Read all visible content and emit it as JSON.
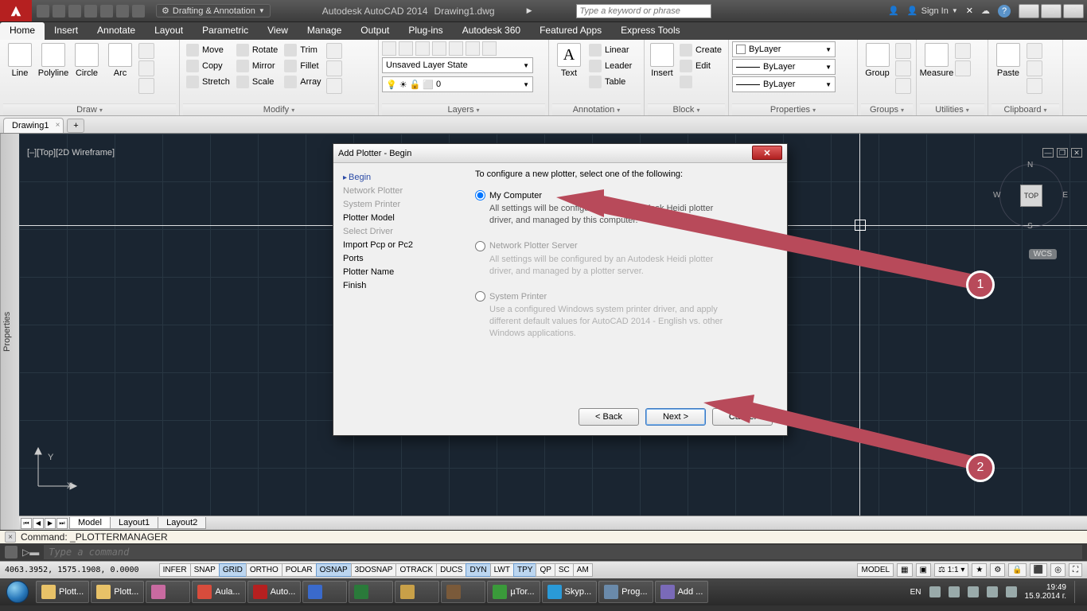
{
  "title": {
    "app": "Autodesk AutoCAD 2014",
    "doc": "Drawing1.dwg"
  },
  "workspace_selector": "Drafting & Annotation",
  "search_placeholder": "Type a keyword or phrase",
  "signin": "Sign In",
  "ribbon_tabs": [
    "Home",
    "Insert",
    "Annotate",
    "Layout",
    "Parametric",
    "View",
    "Manage",
    "Output",
    "Plug-ins",
    "Autodesk 360",
    "Featured Apps",
    "Express Tools"
  ],
  "active_ribbon_tab": 0,
  "panels": {
    "draw": {
      "title": "Draw",
      "items": [
        "Line",
        "Polyline",
        "Circle",
        "Arc"
      ]
    },
    "modify": {
      "title": "Modify",
      "rows": [
        [
          "Move",
          "Rotate",
          "Trim"
        ],
        [
          "Copy",
          "Mirror",
          "Fillet"
        ],
        [
          "Stretch",
          "Scale",
          "Array"
        ]
      ]
    },
    "layers": {
      "title": "Layers",
      "state": "Unsaved Layer State",
      "current": "0"
    },
    "annotation": {
      "title": "Annotation",
      "text": "Text",
      "items": [
        "Linear",
        "Leader",
        "Table"
      ]
    },
    "block": {
      "title": "Block",
      "insert": "Insert",
      "items": [
        "Create",
        "Edit"
      ]
    },
    "properties": {
      "title": "Properties",
      "combos": [
        "ByLayer",
        "ByLayer",
        "ByLayer"
      ]
    },
    "groups": {
      "title": "Groups",
      "label": "Group"
    },
    "utilities": {
      "title": "Utilities",
      "label": "Measure"
    },
    "clipboard": {
      "title": "Clipboard",
      "label": "Paste"
    }
  },
  "doc_tab": "Drawing1",
  "viewport_label": "[–][Top][2D Wireframe]",
  "viewcube": {
    "face": "TOP",
    "n": "N",
    "s": "S",
    "e": "E",
    "w": "W",
    "wcs": "WCS"
  },
  "dialog": {
    "title": "Add Plotter - Begin",
    "steps": [
      {
        "label": "Begin",
        "state": "cur"
      },
      {
        "label": "Network Plotter",
        "state": "muted"
      },
      {
        "label": "System Printer",
        "state": "muted"
      },
      {
        "label": "Plotter Model",
        "state": ""
      },
      {
        "label": "Select Driver",
        "state": "muted"
      },
      {
        "label": "Import Pcp or Pc2",
        "state": ""
      },
      {
        "label": "Ports",
        "state": ""
      },
      {
        "label": "Plotter Name",
        "state": ""
      },
      {
        "label": "Finish",
        "state": ""
      }
    ],
    "heading": "To configure a new plotter, select one of the following:",
    "options": [
      {
        "label": "My Computer",
        "desc": "All settings will be configured by an Autodesk Heidi plotter driver, and managed by this computer.",
        "checked": true,
        "enabled": true
      },
      {
        "label": "Network Plotter Server",
        "desc": "All settings will be configured by an Autodesk Heidi plotter driver, and managed by a plotter server.",
        "checked": false,
        "enabled": false
      },
      {
        "label": "System Printer",
        "desc": "Use a configured Windows system printer driver, and apply different default values for AutoCAD 2014 - English vs. other Windows applications.",
        "checked": false,
        "enabled": false
      }
    ],
    "buttons": {
      "back": "< Back",
      "next": "Next >",
      "cancel": "Cancel"
    }
  },
  "annotations": {
    "badge1": "1",
    "badge2": "2"
  },
  "layout_tabs": [
    "Model",
    "Layout1",
    "Layout2"
  ],
  "command": {
    "history": "Command: _PLOTTERMANAGER",
    "placeholder": "Type a command"
  },
  "status": {
    "coords": "4063.3952, 1575.1908, 0.0000",
    "toggles": [
      {
        "t": "INFER",
        "on": false
      },
      {
        "t": "SNAP",
        "on": false
      },
      {
        "t": "GRID",
        "on": true
      },
      {
        "t": "ORTHO",
        "on": false
      },
      {
        "t": "POLAR",
        "on": false
      },
      {
        "t": "OSNAP",
        "on": true
      },
      {
        "t": "3DOSNAP",
        "on": false
      },
      {
        "t": "OTRACK",
        "on": false
      },
      {
        "t": "DUCS",
        "on": false
      },
      {
        "t": "DYN",
        "on": true
      },
      {
        "t": "LWT",
        "on": false
      },
      {
        "t": "TPY",
        "on": true
      },
      {
        "t": "QP",
        "on": false
      },
      {
        "t": "SC",
        "on": false
      },
      {
        "t": "AM",
        "on": false
      }
    ],
    "model": "MODEL",
    "scale": "1:1"
  },
  "taskbar": {
    "items": [
      "Plott...",
      "Plott...",
      "",
      "Aula...",
      "Auto...",
      "",
      "",
      "",
      "",
      "µTor...",
      "Skyp...",
      "Prog...",
      "Add ..."
    ],
    "lang": "EN",
    "time": "19:49",
    "date": "15.9.2014 г."
  }
}
